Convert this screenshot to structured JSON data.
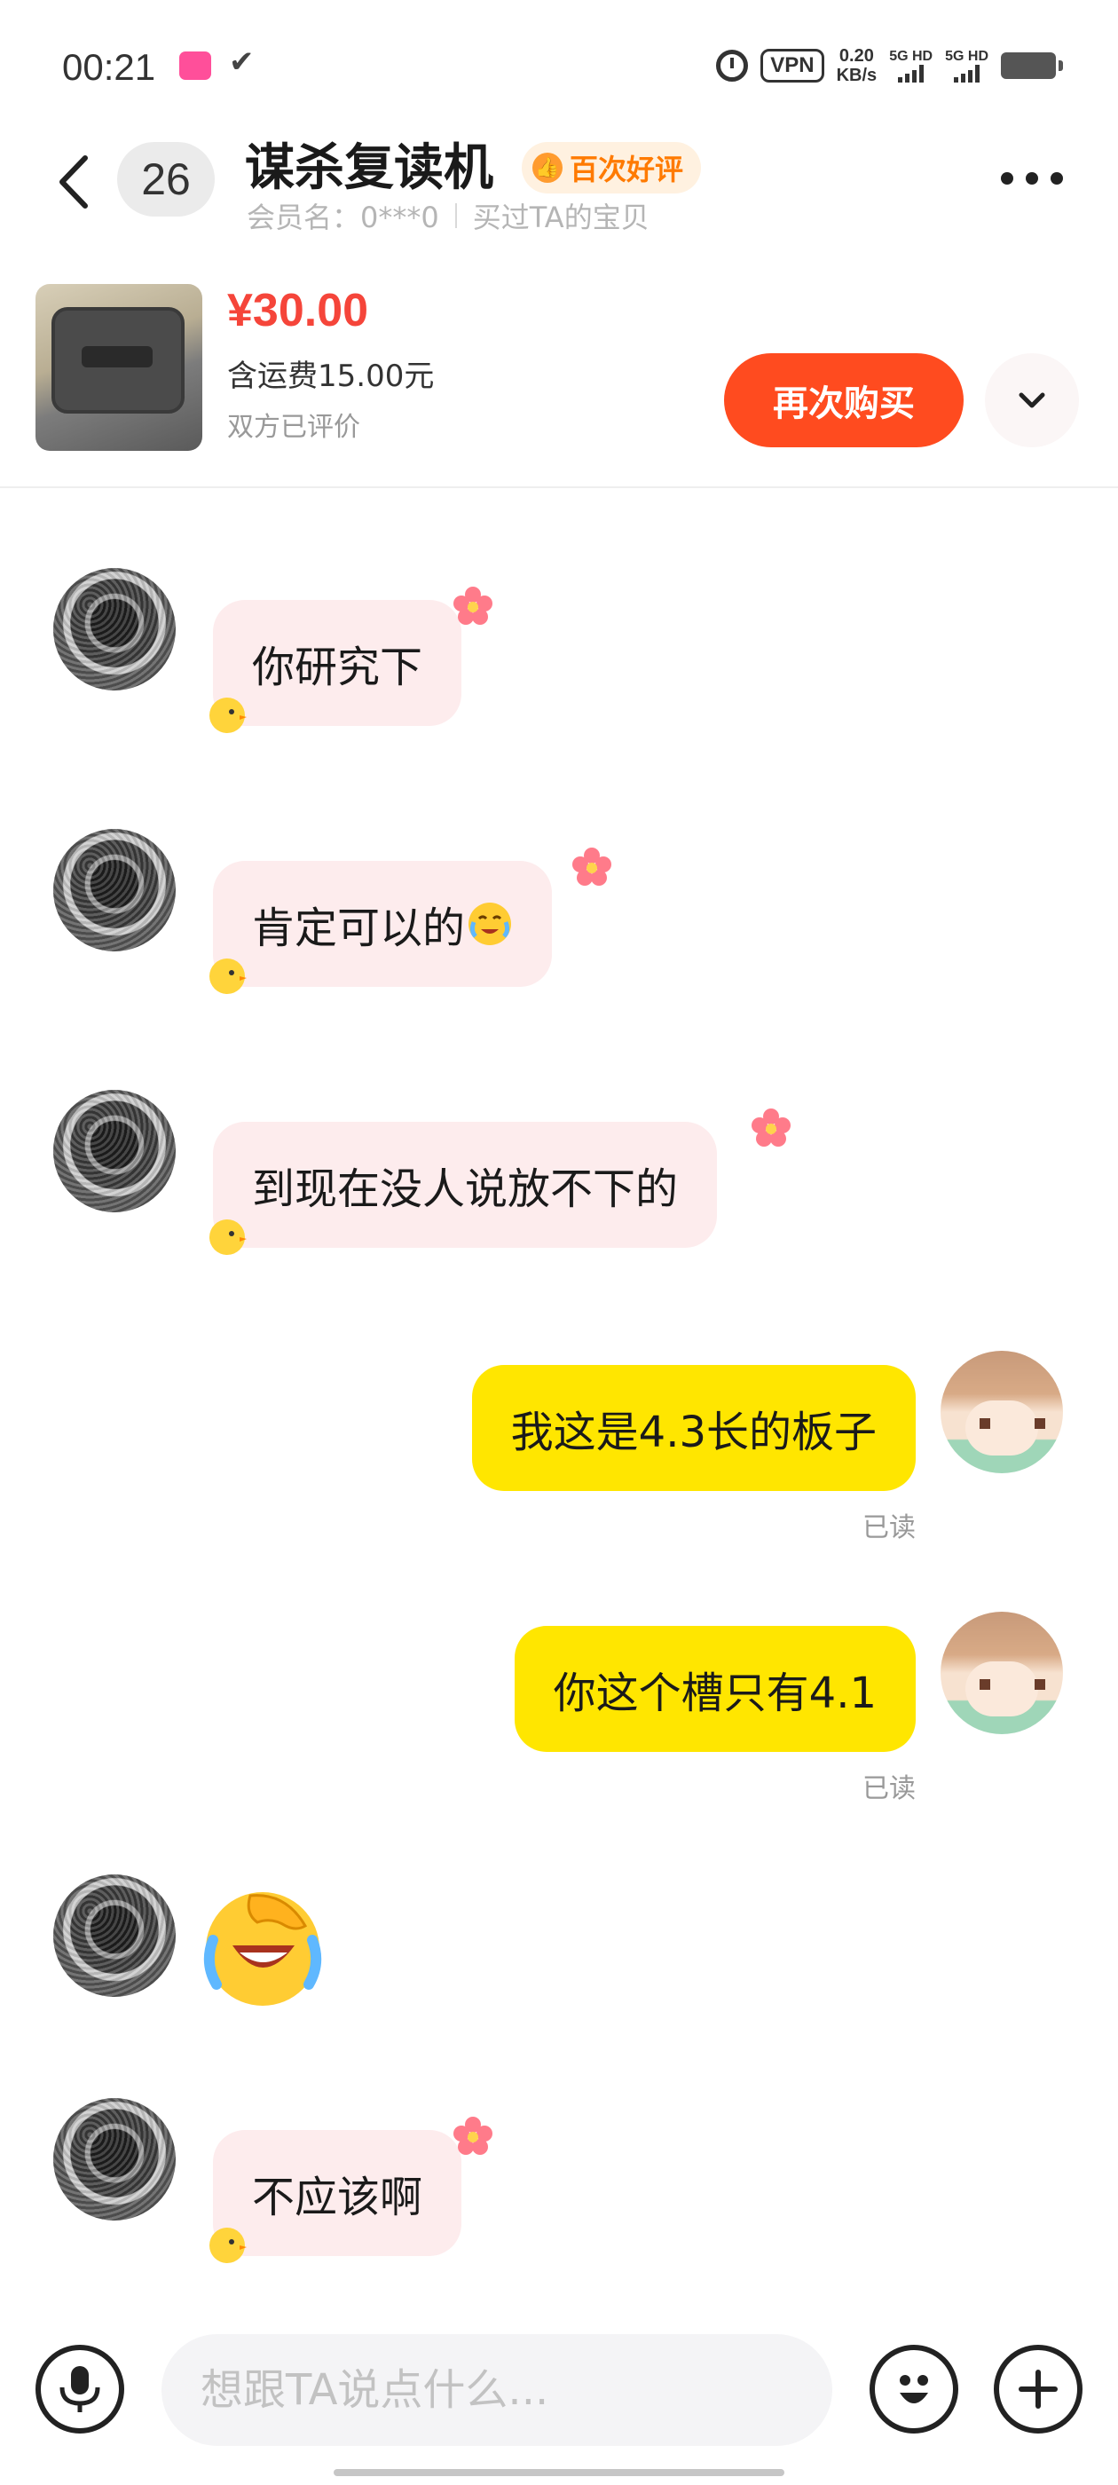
{
  "status_bar": {
    "time": "00:21",
    "check": "✔",
    "vpn": "VPN",
    "speed_value": "0.20",
    "speed_unit": "KB/s",
    "net1": "5G HD",
    "net2": "5G HD"
  },
  "header": {
    "unread_count": "26",
    "title": "谋杀复读机",
    "badge": "百次好评",
    "member_label": "会员名：0***0",
    "bought_label": "买过TA的宝贝"
  },
  "product": {
    "price": "¥30.00",
    "shipping": "含运费15.00元",
    "review_status": "双方已评价",
    "buy_again_label": "再次购买"
  },
  "messages": [
    {
      "side": "left",
      "text": "你研究下"
    },
    {
      "side": "left",
      "text": "肯定可以的"
    },
    {
      "side": "left",
      "text": "到现在没人说放不下的"
    },
    {
      "side": "right",
      "text": "我这是4.3长的板子",
      "status": "已读"
    },
    {
      "side": "right",
      "text": "你这个槽只有4.1",
      "status": "已读"
    },
    {
      "side": "left",
      "emoji": "facepalm-crying-emoji"
    },
    {
      "side": "left",
      "text": "不应该啊"
    }
  ],
  "input": {
    "placeholder": "想跟TA说点什么..."
  },
  "colors": {
    "accent": "#ff4b1f",
    "price": "#f5453a",
    "own_bubble": "#ffe600",
    "other_bubble": "#fdeced",
    "badge_text": "#ff7a00"
  }
}
